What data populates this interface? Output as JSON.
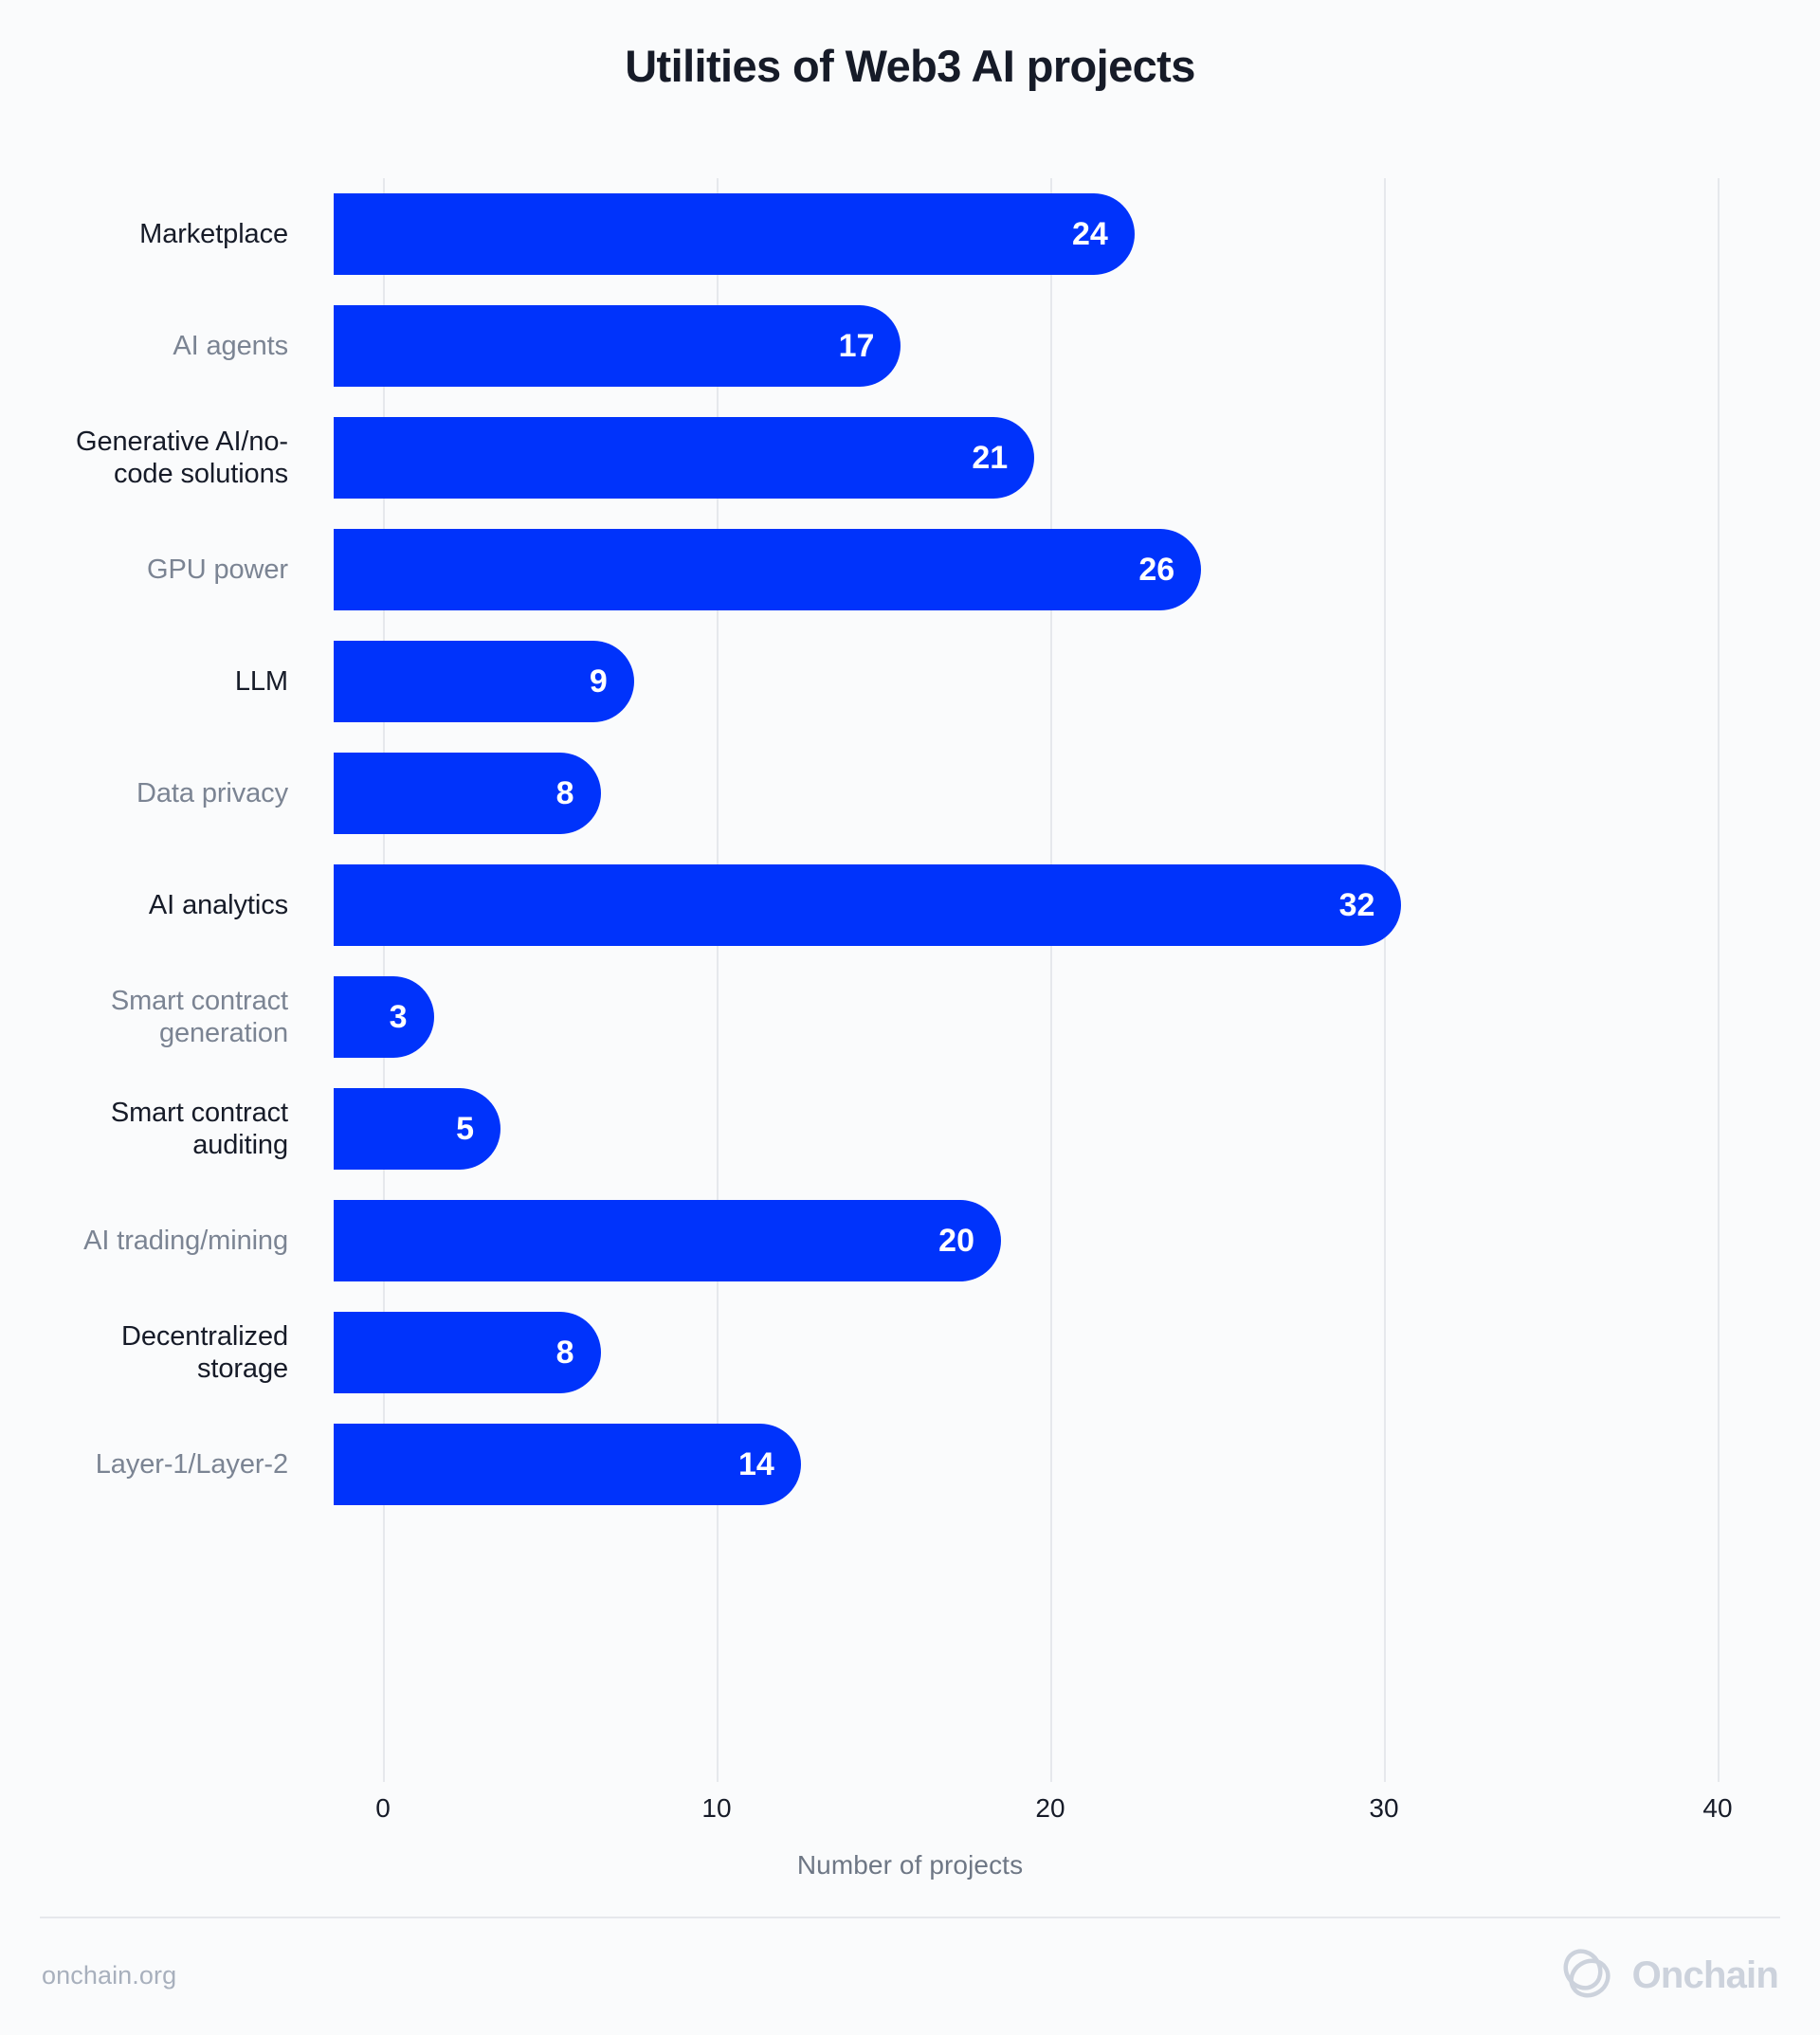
{
  "header": {
    "title": "Utilities of Web3 AI projects"
  },
  "footer": {
    "site": "onchain.org",
    "brand_name": "Onchain",
    "brand_mark_icon": "onchain-loops-logo-icon"
  },
  "colors": {
    "bar": "#0033fb",
    "label_dark": "#161b28",
    "label_gray": "#7b8493",
    "gridline": "#e6e8ec",
    "background": "#fafbfc",
    "value_text": "#ffffff",
    "brand": "#ccd2dc"
  },
  "chart_data": {
    "type": "bar",
    "orientation": "horizontal",
    "title": "Utilities of Web3 AI projects",
    "xlabel": "Number of projects",
    "ylabel": "",
    "xlim": [
      0,
      40
    ],
    "xticks": [
      0,
      10,
      20,
      30,
      40
    ],
    "xtick_labels": [
      "0",
      "10",
      "20",
      "30",
      "40"
    ],
    "grid": "vertical",
    "legend": "none",
    "value_labels": true,
    "categories": [
      "Marketplace",
      "AI agents",
      "Generative AI/no-\ncode solutions",
      "GPU power",
      "LLM",
      "Data privacy",
      "AI analytics",
      "Smart contract\ngeneration",
      "Smart contract\nauditing",
      "AI trading/mining",
      "Decentralized\nstorage",
      "Layer-1/Layer-2"
    ],
    "values": [
      24,
      17,
      21,
      26,
      9,
      8,
      32,
      3,
      5,
      20,
      8,
      14
    ],
    "label_styles": [
      "dark",
      "gray",
      "dark",
      "gray",
      "dark",
      "gray",
      "dark",
      "gray",
      "dark",
      "gray",
      "dark",
      "gray"
    ]
  }
}
